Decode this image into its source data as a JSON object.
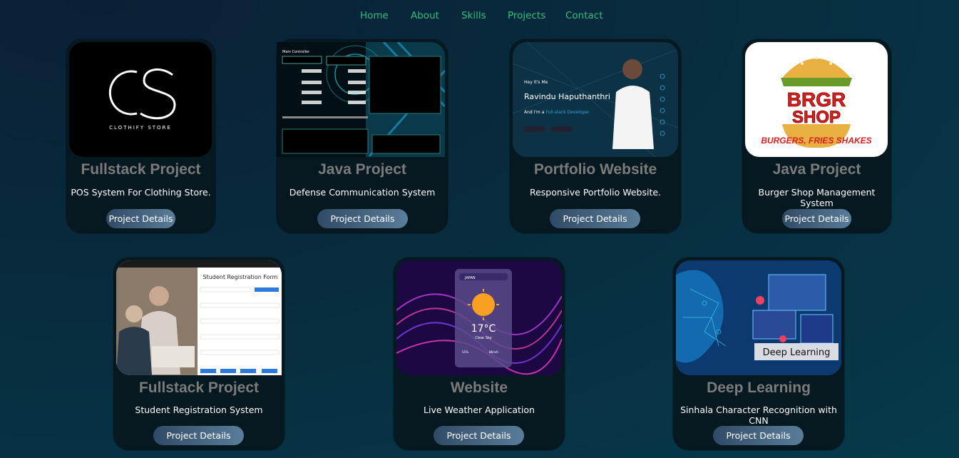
{
  "nav": {
    "items": [
      {
        "label": "Home"
      },
      {
        "label": "About"
      },
      {
        "label": "Skills"
      },
      {
        "label": "Projects"
      },
      {
        "label": "Contact"
      }
    ]
  },
  "projects": [
    {
      "title": "Fullstack Project",
      "desc": "POS System For Clothing Store.",
      "button": "Project Details",
      "thumb_text": "CLOTHIFY STORE"
    },
    {
      "title": "Java Project",
      "desc": "Defense Communication System",
      "button": "Project Details",
      "thumb_text": "Main Controller"
    },
    {
      "title": "Portfolio Website",
      "desc": "Responsive Portfolio Website.",
      "button": "Project Details",
      "thumb_text": "Ravindu Haputhanthri"
    },
    {
      "title": "Java Project",
      "desc": "Burger Shop Management System",
      "button": "Project Details",
      "thumb_text": "BRGR SHOP"
    },
    {
      "title": "Fullstack Project",
      "desc": "Student Registration System",
      "button": "Project Details",
      "thumb_text": "Student Registration Form"
    },
    {
      "title": "Website",
      "desc": "Live Weather Application",
      "button": "Project Details",
      "thumb_text": "17°C"
    },
    {
      "title": "Deep Learning",
      "desc": "Sinhala Character Recognition with CNN",
      "button": "Project Details",
      "thumb_text": "Deep Learning"
    }
  ],
  "colors": {
    "nav_link": "#2fbf80",
    "card_bg": "#061820",
    "title": "#7b7b7b",
    "button_from": "#304a66",
    "button_to": "#5a7d99"
  }
}
